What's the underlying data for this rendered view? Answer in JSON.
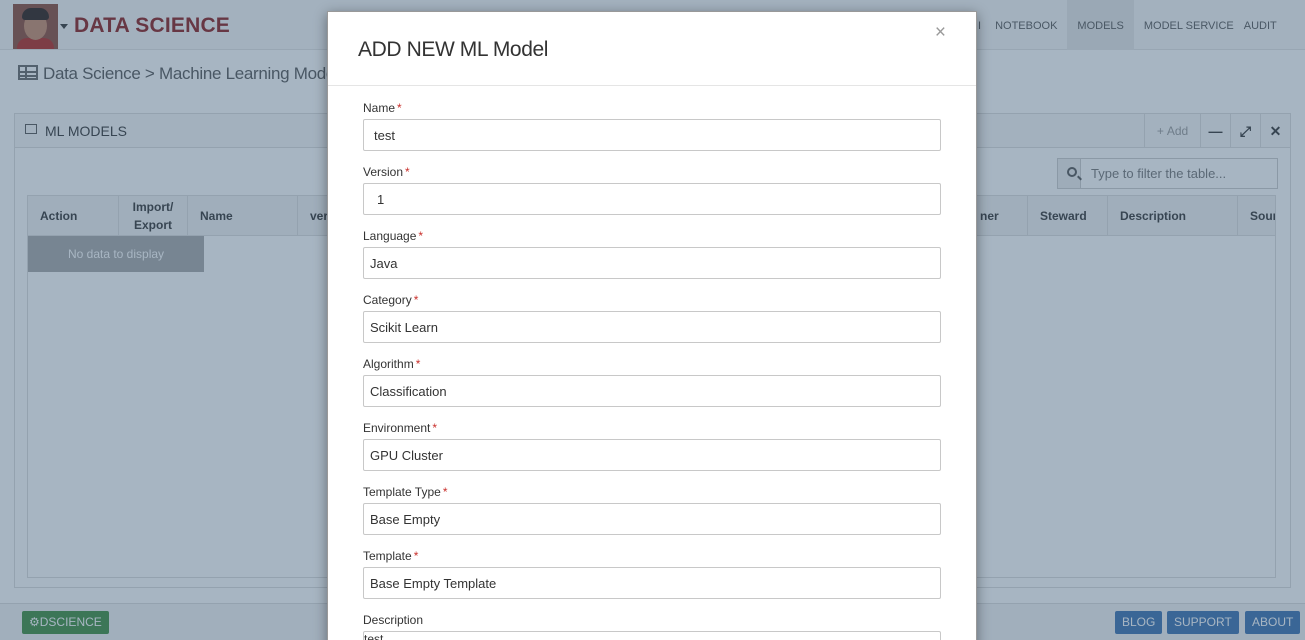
{
  "app": {
    "brand": "DATA SCIENCE",
    "nav": [
      {
        "label": "NOTEBOOK",
        "active": false
      },
      {
        "label": "MODELS",
        "active": true
      },
      {
        "label": "MODEL SERVICE",
        "active": false
      },
      {
        "label": "AUDIT",
        "active": false
      }
    ],
    "partial_nav_tail": "I"
  },
  "breadcrumb": "Data Science > Machine Learning Models",
  "panel": {
    "title": "ML MODELS",
    "add_label": "Add",
    "filter_placeholder": "Type to filter the table...",
    "columns": [
      "Action",
      "Import/ Export",
      "Name",
      "ver",
      "ner",
      "Steward",
      "Description",
      "Sour"
    ],
    "no_data": "No data to display"
  },
  "footer": {
    "dscience": "DSCIENCE",
    "blog": "BLOG",
    "support": "SUPPORT",
    "about": "ABOUT"
  },
  "modal": {
    "title": "ADD NEW ML Model",
    "close_symbol": "×",
    "required_mark": "*",
    "fields": {
      "name": {
        "label": "Name",
        "value": "test"
      },
      "version": {
        "label": "Version",
        "value": "1"
      },
      "language": {
        "label": "Language",
        "value": "Java"
      },
      "category": {
        "label": "Category",
        "value": "Scikit Learn"
      },
      "algorithm": {
        "label": "Algorithm",
        "value": "Classification"
      },
      "environment": {
        "label": "Environment",
        "value": "GPU Cluster"
      },
      "template_type": {
        "label": "Template Type",
        "value": "Base Empty"
      },
      "template": {
        "label": "Template",
        "value": "Base Empty Template"
      },
      "description": {
        "label": "Description",
        "value": "test"
      }
    }
  },
  "colors": {
    "brand": "#8b1a1a",
    "required": "#c9302c",
    "footer_green": "#3c8d3c",
    "footer_blue": "#3a6fb0"
  }
}
